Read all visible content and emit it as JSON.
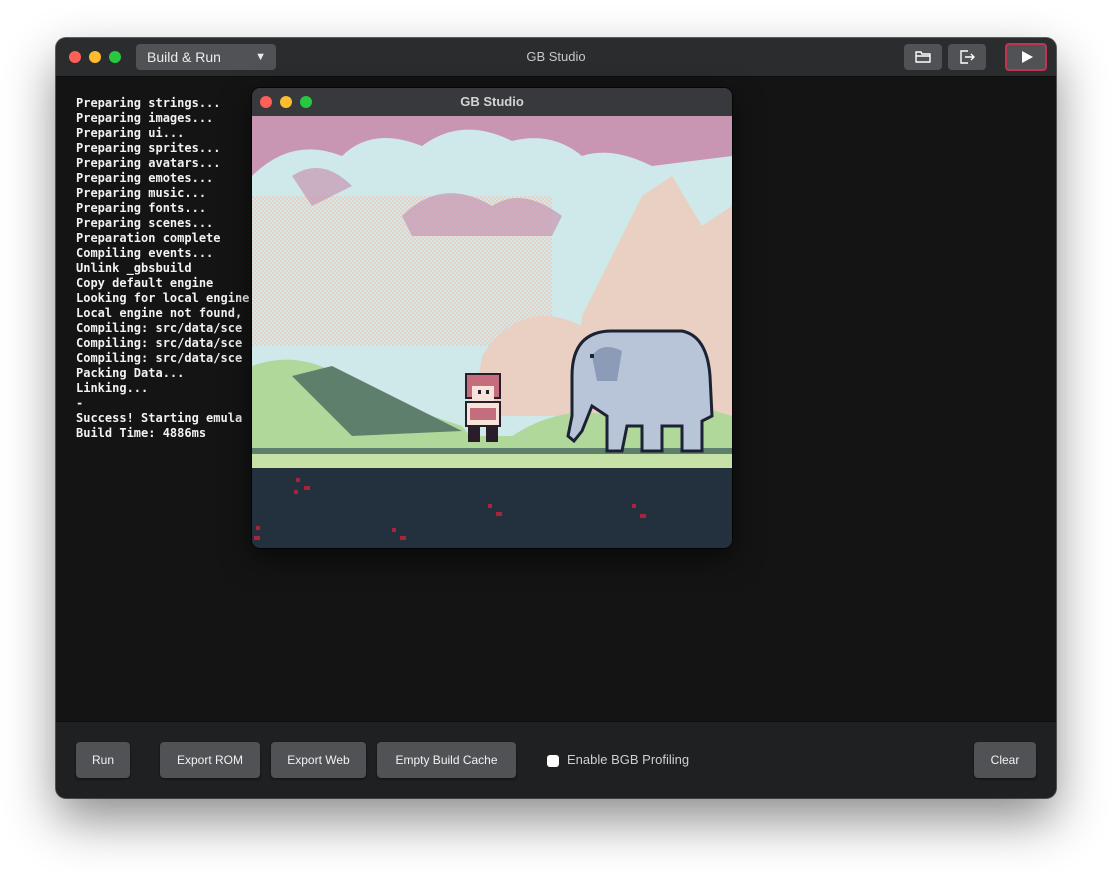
{
  "window": {
    "title": "GB Studio",
    "mode_select": "Build & Run"
  },
  "toolbar": {
    "open_folder_icon": "folder-open-icon",
    "export_icon": "export-icon",
    "run_icon": "play-icon"
  },
  "console": {
    "lines": [
      "Preparing strings...",
      "Preparing images...",
      "Preparing ui...",
      "Preparing sprites...",
      "Preparing avatars...",
      "Preparing emotes...",
      "Preparing music...",
      "Preparing fonts...",
      "Preparing scenes...",
      "Preparation complete",
      "Compiling events...",
      "Unlink _gbsbuild",
      "Copy default engine",
      "Looking for local engine",
      "Local engine not found,",
      "Compiling: src/data/sce",
      "Compiling: src/data/sce",
      "Compiling: src/data/sce",
      "Packing Data...",
      "Linking...",
      "-",
      "Success! Starting emula",
      "Build Time: 4886ms"
    ]
  },
  "footer": {
    "run_label": "Run",
    "export_rom_label": "Export ROM",
    "export_web_label": "Export Web",
    "empty_cache_label": "Empty Build Cache",
    "profiling_label": "Enable BGB Profiling",
    "profiling_checked": false,
    "clear_label": "Clear"
  },
  "emulator": {
    "title": "GB Studio"
  },
  "colors": {
    "sky_pink": "#c895b2",
    "cloud_cyan": "#cfe9ea",
    "cloud_peach": "#e9d0c3",
    "grass_green": "#b1d89b",
    "hill_dark": "#5f7f6d",
    "ground_navy": "#23303e",
    "flower_red": "#a8243c",
    "run_border": "#c0344f"
  }
}
